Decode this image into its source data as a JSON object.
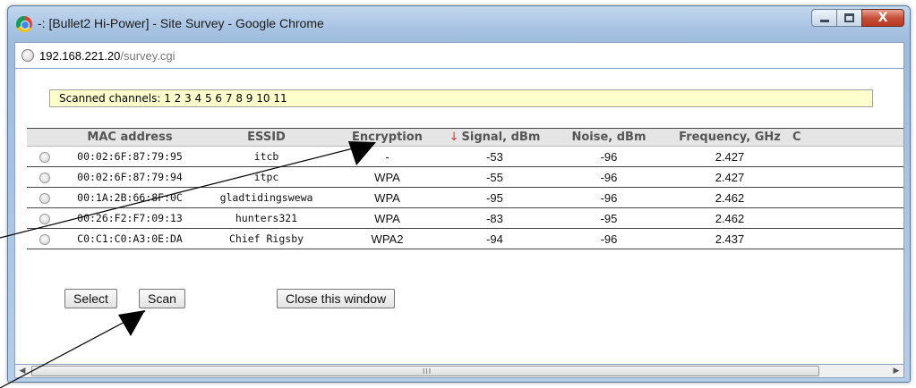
{
  "window": {
    "title": "-: [Bullet2 Hi-Power] - Site Survey - Google Chrome",
    "browser_icon": "chrome-icon",
    "controls": {
      "minimize_icon": "minimize-icon",
      "maximize_icon": "maximize-icon",
      "close_icon": "close-icon",
      "close_glyph": "X"
    }
  },
  "address": {
    "host": "192.168.221.20",
    "path": "/survey.cgi",
    "icon": "page-icon"
  },
  "scanned_channels": "Scanned channels: 1 2 3 4 5 6 7 8 9 10 11",
  "table": {
    "headers": {
      "mac": "MAC address",
      "essid": "ESSID",
      "encryption": "Encryption",
      "signal_arrow": "↓",
      "signal": "Signal, dBm",
      "noise": "Noise, dBm",
      "frequency": "Frequency, GHz",
      "truncated": "C"
    },
    "rows": [
      {
        "mac": "00:02:6F:87:79:95",
        "essid": "itcb",
        "encryption": "-",
        "signal": "-53",
        "noise": "-96",
        "frequency": "2.427"
      },
      {
        "mac": "00:02:6F:87:79:94",
        "essid": "itpc",
        "encryption": "WPA",
        "signal": "-55",
        "noise": "-96",
        "frequency": "2.427"
      },
      {
        "mac": "00:1A:2B:66:8F:0C",
        "essid": "gladtidingswewa",
        "encryption": "WPA",
        "signal": "-95",
        "noise": "-96",
        "frequency": "2.462"
      },
      {
        "mac": "00:26:F2:F7:09:13",
        "essid": "hunters321",
        "encryption": "WPA",
        "signal": "-83",
        "noise": "-95",
        "frequency": "2.462"
      },
      {
        "mac": "C0:C1:C0:A3:0E:DA",
        "essid": "Chief Rigsby",
        "encryption": "WPA2",
        "signal": "-94",
        "noise": "-96",
        "frequency": "2.437"
      }
    ]
  },
  "buttons": {
    "select": "Select",
    "scan": "Scan",
    "close": "Close this window"
  },
  "scrollbar": {
    "grip": "III",
    "left_arrow": "◀",
    "right_arrow": "▶"
  },
  "colors": {
    "title_bar": "#a9c4e3",
    "scanned_bg": "#ffffcc",
    "header_bg": "#e5e5e5",
    "close_button": "#c7503a",
    "sort_arrow": "#dd3333"
  }
}
